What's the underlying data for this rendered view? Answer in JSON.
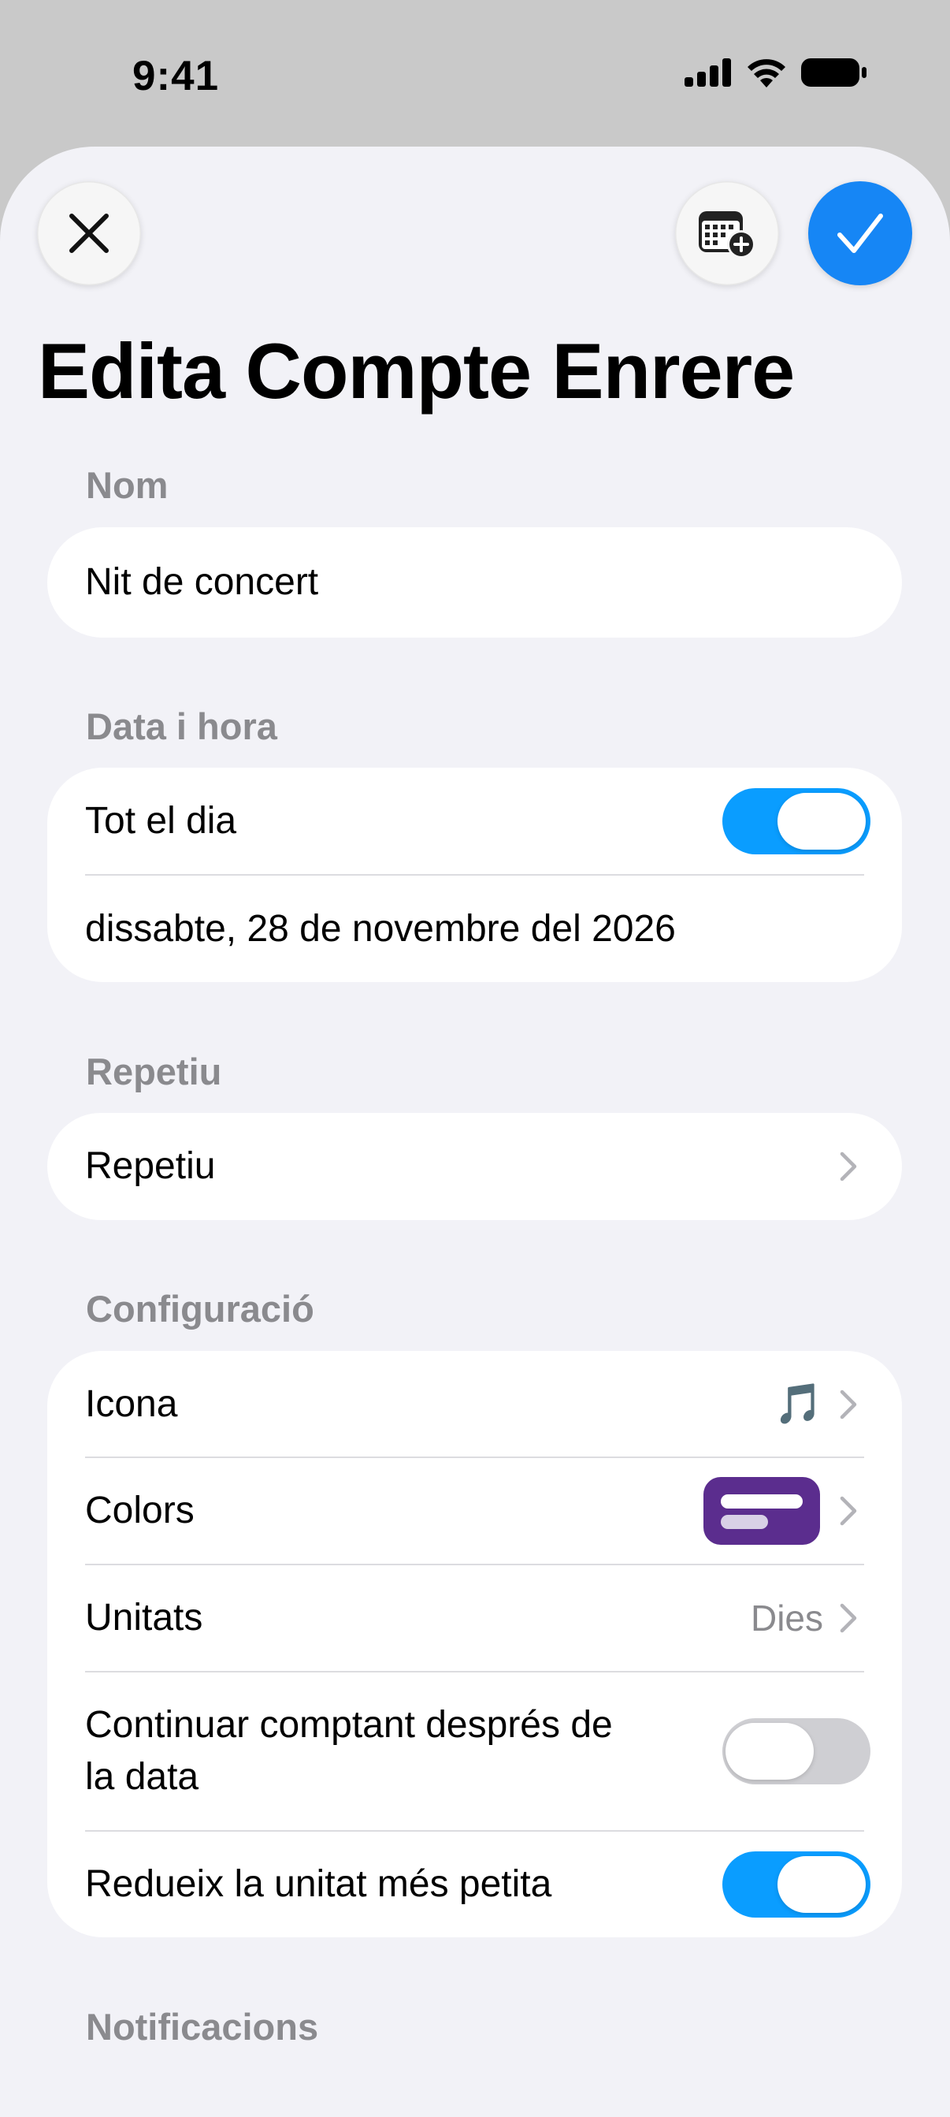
{
  "status_bar": {
    "time": "9:41",
    "icons": [
      "cellular-signal-icon",
      "wifi-icon",
      "battery-icon"
    ]
  },
  "header": {
    "title": "Edita Compte Enrere",
    "buttons": [
      "close-icon",
      "calendar-add-icon",
      "checkmark-icon"
    ]
  },
  "sections": {
    "name": {
      "label": "Nom",
      "value": "Nit de concert"
    },
    "datetime": {
      "label": "Data i hora",
      "all_day_label": "Tot el dia",
      "all_day_on": true,
      "date_value": "dissabte, 28 de novembre del 2026"
    },
    "repeat": {
      "label": "Repetiu",
      "row_label": "Repetiu"
    },
    "settings": {
      "label": "Configuració",
      "icon_label": "Icona",
      "icon_value": "🎵",
      "colors_label": "Colors",
      "colors_value": "#5b2d8e",
      "units_label": "Unitats",
      "units_value": "Dies",
      "continue_label_line1": "Continuar comptant després de",
      "continue_label_line2": "la data",
      "continue_on": false,
      "reduce_label": "Redueix la unitat més petita",
      "reduce_on": true
    },
    "notifications": {
      "label": "Notificacions"
    }
  },
  "colors": {
    "accent": "#0a9dff",
    "confirm": "#1686f5",
    "background": "#f2f2f7",
    "secondary_text": "#8a8a8e"
  }
}
